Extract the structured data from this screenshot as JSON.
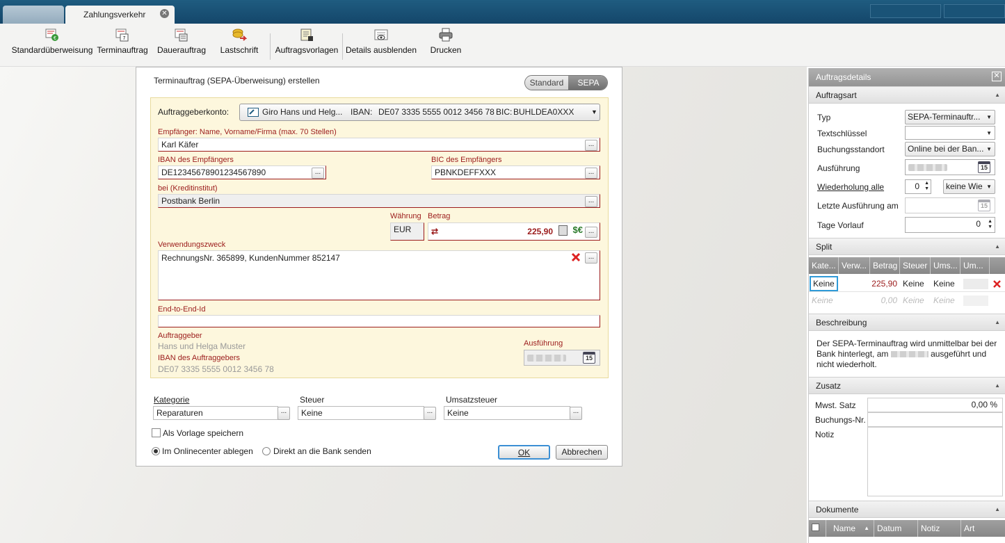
{
  "tabs": {
    "active": "Zahlungsverkehr",
    "close_glyph": "✕"
  },
  "toolbar": [
    {
      "label": "Standardüberweisung",
      "icon": "standard-transfer-icon"
    },
    {
      "label": "Terminauftrag",
      "icon": "scheduled-order-icon"
    },
    {
      "label": "Dauerauftrag",
      "icon": "standing-order-icon"
    },
    {
      "label": "Lastschrift",
      "icon": "direct-debit-icon"
    },
    {
      "label": "Auftragsvorlagen",
      "icon": "order-templates-icon"
    },
    {
      "label": "Details ausblenden",
      "icon": "hide-details-icon"
    },
    {
      "label": "Drucken",
      "icon": "printer-icon"
    }
  ],
  "dialog": {
    "title": "Terminauftrag (SEPA-Überweisung) erstellen",
    "toggle": {
      "standard": "Standard",
      "sepa": "SEPA",
      "active": "SEPA"
    },
    "account": {
      "label": "Auftraggeberkonto:",
      "name": "Giro Hans und Helg...",
      "iban_label": "IBAN:",
      "iban": "DE07 3335 5555 0012 3456 78",
      "bic_label": "BIC:",
      "bic": "BUHLDEA0XXX"
    },
    "recipient": {
      "label": "Empfänger: Name, Vorname/Firma (max. 70 Stellen)",
      "value": "Karl Käfer"
    },
    "iban": {
      "label": "IBAN des Empfängers",
      "value": "DE12345678901234567890"
    },
    "bic": {
      "label": "BIC des Empfängers",
      "value": "PBNKDEFFXXX"
    },
    "bank": {
      "label": "bei (Kreditinstitut)",
      "value": "Postbank Berlin"
    },
    "currency": {
      "label": "Währung",
      "value": "EUR"
    },
    "amount": {
      "label": "Betrag",
      "value": "225,90"
    },
    "purpose": {
      "label": "Verwendungszweck",
      "value": "RechnungsNr. 365899, KundenNummer 852147"
    },
    "e2e": {
      "label": "End-to-End-Id",
      "value": ""
    },
    "originator": {
      "label": "Auftraggeber",
      "value": "Hans und Helga Muster",
      "iban_label": "IBAN des Auftraggebers",
      "iban": "DE07 3335 5555 0012 3456 78"
    },
    "execution": {
      "label": "Ausführung",
      "calendar_day": "15"
    },
    "kategorie": {
      "label": "Kategorie",
      "value": "Reparaturen"
    },
    "steuer": {
      "label": "Steuer",
      "value": "Keine"
    },
    "umsatzsteuer": {
      "label": "Umsatzsteuer",
      "value": "Keine"
    },
    "save_template": "Als Vorlage speichern",
    "radio_online": "Im Onlinecenter ablegen",
    "radio_bank": "Direkt an die Bank senden",
    "ok": "OK",
    "cancel": "Abbrechen",
    "dots": "..."
  },
  "side": {
    "title": "Auftragsdetails",
    "auftragsart": {
      "header": "Auftragsart",
      "typ": {
        "label": "Typ",
        "value": "SEPA-Terminauftr..."
      },
      "textschluessel": {
        "label": "Textschlüssel",
        "value": ""
      },
      "standort": {
        "label": "Buchungsstandort",
        "value": "Online bei der Ban..."
      },
      "ausfuehrung": {
        "label": "Ausführung",
        "calendar_day": "15"
      },
      "wiederholung": {
        "label": "Wiederholung alle",
        "count": "0",
        "unit": "keine Wie"
      },
      "letzte": {
        "label": "Letzte Ausführung am",
        "calendar_day": "15"
      },
      "vorlauf": {
        "label": "Tage Vorlauf",
        "value": "0"
      }
    },
    "split": {
      "header": "Split",
      "columns": [
        "Kate...",
        "Verw...",
        "Betrag",
        "Steuer",
        "Ums...",
        "Um..."
      ],
      "rows": [
        [
          "Keine",
          "",
          "225,90",
          "Keine",
          "Keine",
          ""
        ],
        [
          "Keine",
          "",
          "0,00",
          "Keine",
          "Keine",
          ""
        ]
      ]
    },
    "beschreibung": {
      "header": "Beschreibung",
      "text1": "Der SEPA-Terminauftrag wird unmittelbar bei der Bank hinterlegt, am",
      "text2": "ausgeführt und nicht wiederholt."
    },
    "zusatz": {
      "header": "Zusatz",
      "mwst_label": "Mwst. Satz",
      "mwst_value": "0,00 %",
      "buchungsnr_label": "Buchungs-Nr.",
      "notiz_label": "Notiz"
    },
    "dokumente": {
      "header": "Dokumente",
      "columns": [
        "Name",
        "Datum",
        "Notiz",
        "Art"
      ]
    }
  },
  "colors": {
    "accent_red": "#9b1b1b",
    "panel_bg": "#fdf7dd",
    "title_bar": "#1f5c80"
  }
}
